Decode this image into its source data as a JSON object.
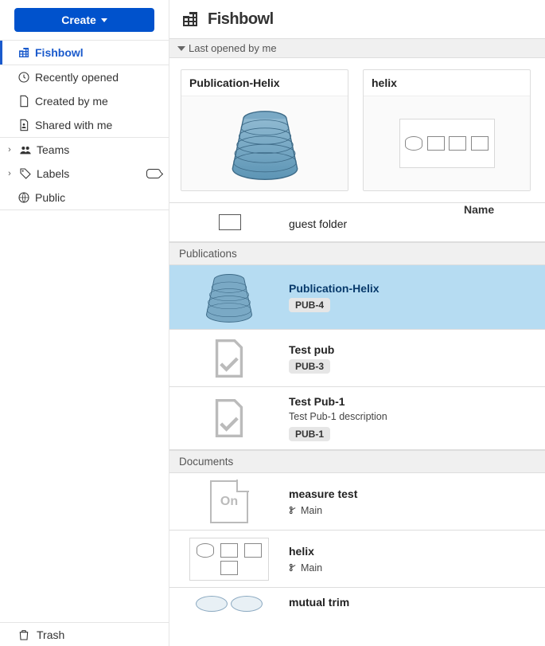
{
  "create_label": "Create",
  "sidebar": {
    "items": [
      {
        "label": "Fishbowl"
      },
      {
        "label": "Recently opened"
      },
      {
        "label": "Created by me"
      },
      {
        "label": "Shared with me"
      },
      {
        "label": "Teams"
      },
      {
        "label": "Labels"
      },
      {
        "label": "Public"
      }
    ],
    "trash_label": "Trash"
  },
  "header": {
    "title": "Fishbowl"
  },
  "section_last_label": "Last opened by me",
  "cards": [
    {
      "title": "Publication-Helix"
    },
    {
      "title": "helix"
    }
  ],
  "column_name_header": "Name",
  "folder_row": {
    "name": "guest folder"
  },
  "group_publications": "Publications",
  "publications": [
    {
      "name": "Publication-Helix",
      "badge": "PUB-4"
    },
    {
      "name": "Test pub",
      "badge": "PUB-3"
    },
    {
      "name": "Test Pub-1",
      "desc": "Test Pub-1 description",
      "badge": "PUB-1"
    }
  ],
  "group_documents": "Documents",
  "documents": [
    {
      "name": "measure test",
      "workspace": "Main"
    },
    {
      "name": "helix",
      "workspace": "Main"
    },
    {
      "name": "mutual trim"
    }
  ]
}
